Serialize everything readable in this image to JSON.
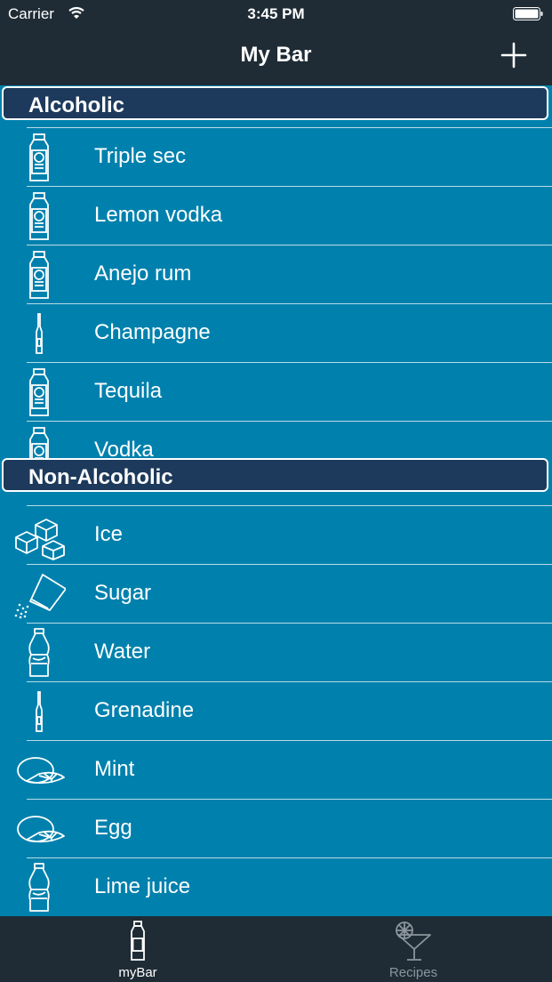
{
  "status": {
    "carrier": "Carrier",
    "time": "3:45 PM"
  },
  "nav": {
    "title": "My Bar",
    "add_icon": "plus-icon"
  },
  "sections": [
    {
      "title": "Alcoholic",
      "items": [
        {
          "label": "Triple sec",
          "icon": "liquor-bottle-icon"
        },
        {
          "label": "Lemon vodka",
          "icon": "liquor-bottle-icon"
        },
        {
          "label": "Anejo rum",
          "icon": "liquor-bottle-icon"
        },
        {
          "label": "Champagne",
          "icon": "thin-bottle-icon"
        },
        {
          "label": "Tequila",
          "icon": "liquor-bottle-icon"
        },
        {
          "label": "Vodka",
          "icon": "liquor-bottle-icon"
        }
      ]
    },
    {
      "title": "Non-Alcoholic",
      "items": [
        {
          "label": "Ice",
          "icon": "ice-cubes-icon"
        },
        {
          "label": "Sugar",
          "icon": "sugar-shaker-icon"
        },
        {
          "label": "Water",
          "icon": "soda-bottle-icon"
        },
        {
          "label": "Grenadine",
          "icon": "thin-bottle-icon"
        },
        {
          "label": "Mint",
          "icon": "citrus-icon"
        },
        {
          "label": "Egg",
          "icon": "citrus-icon"
        },
        {
          "label": "Lime juice",
          "icon": "soda-bottle-icon"
        }
      ]
    }
  ],
  "tabs": [
    {
      "label": "myBar",
      "icon": "bottle-icon",
      "active": true
    },
    {
      "label": "Recipes",
      "icon": "cocktail-glass-icon",
      "active": false
    }
  ]
}
